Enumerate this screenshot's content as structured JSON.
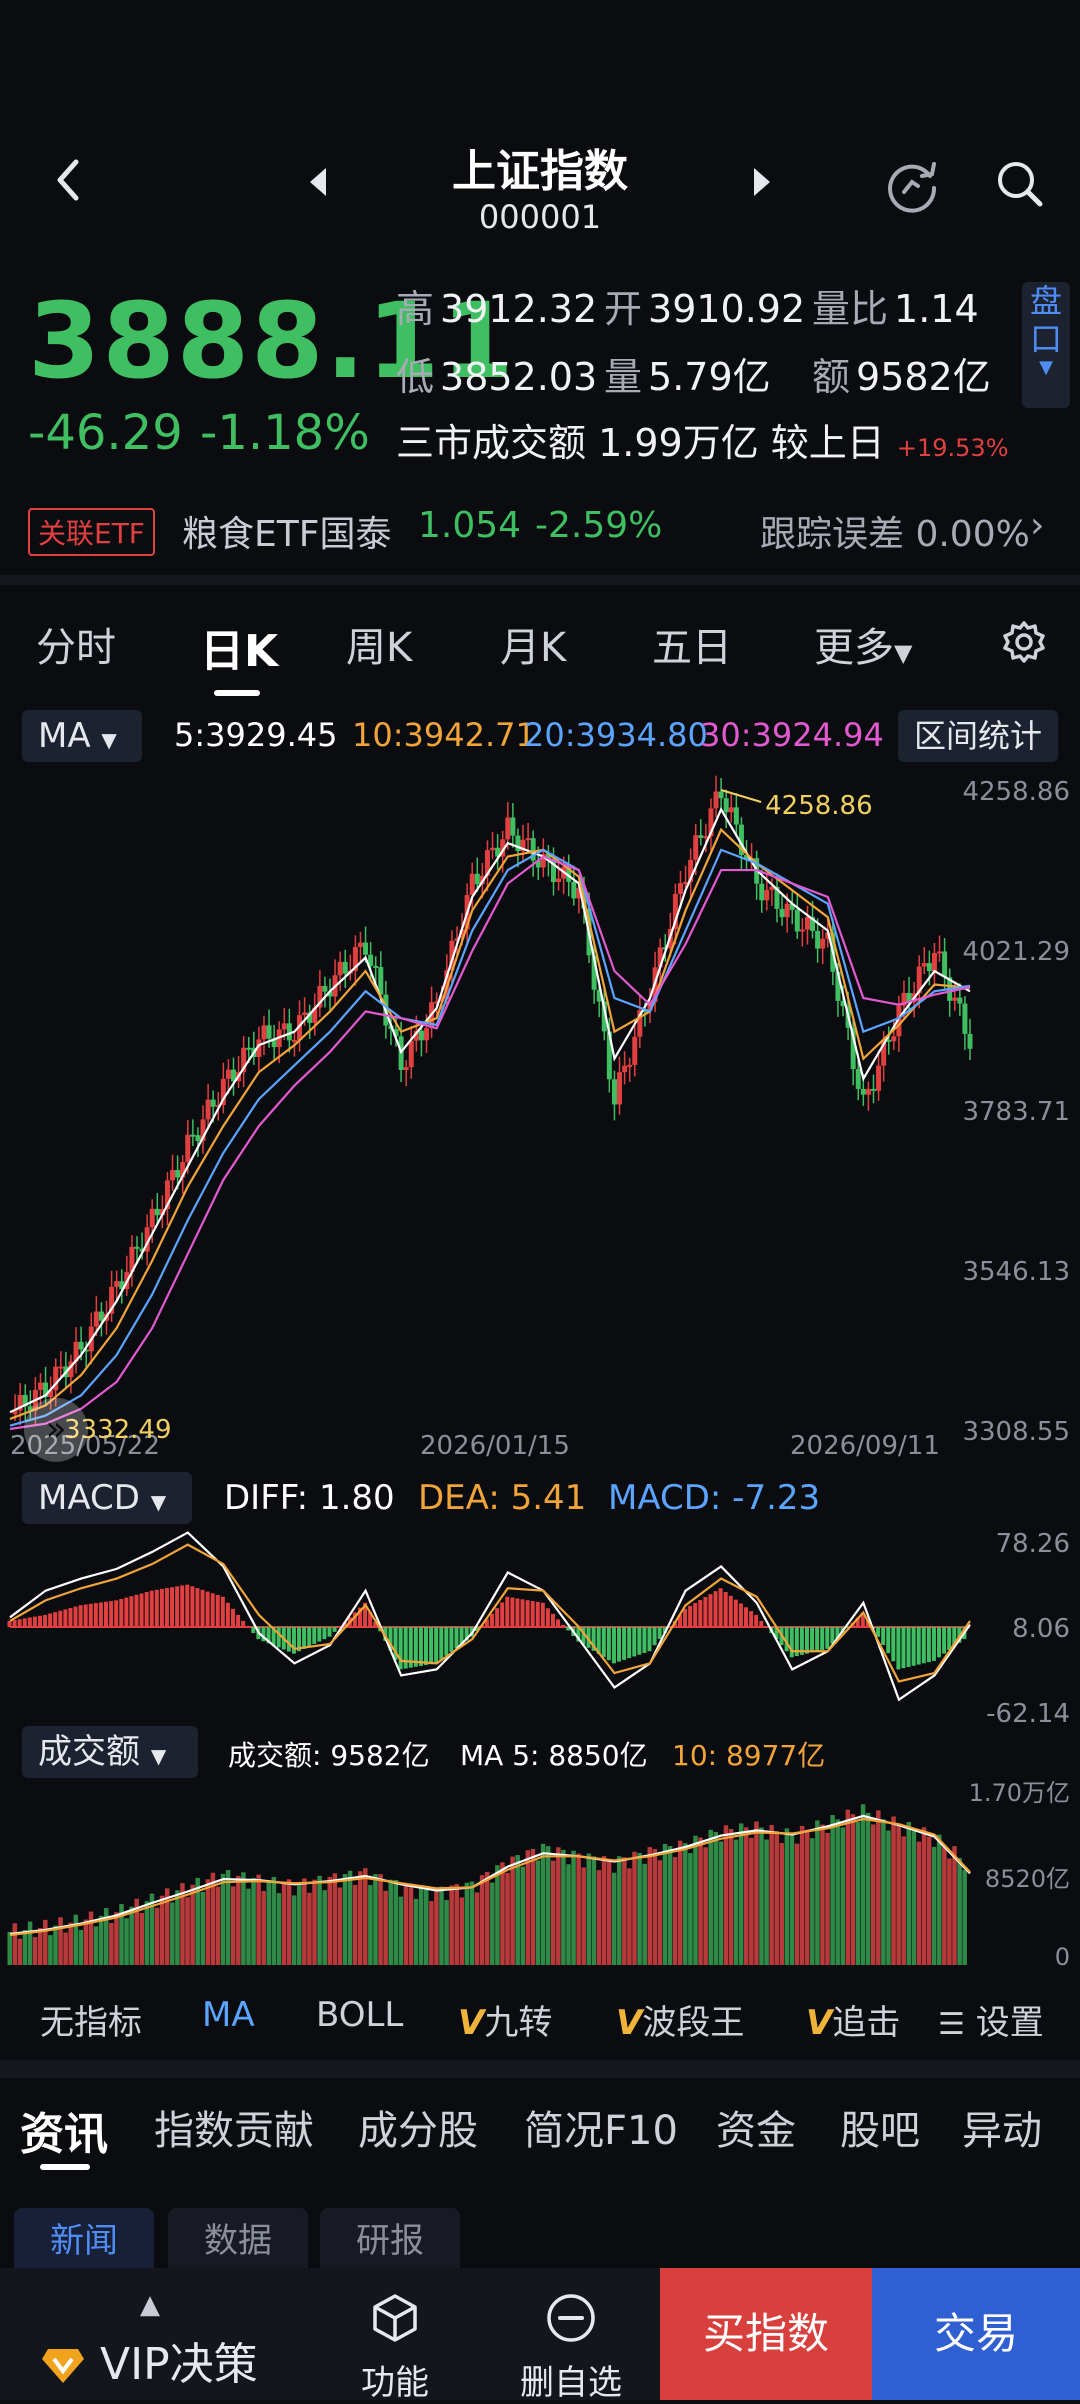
{
  "header": {
    "title": "上证指数",
    "code": "000001"
  },
  "quote": {
    "price": "3888.11",
    "change": "-46.29",
    "change_pct": "-1.18%",
    "high_label": "高",
    "high": "3912.32",
    "open_label": "开",
    "open": "3910.92",
    "vol_ratio_label": "量比",
    "vol_ratio": "1.14",
    "low_label": "低",
    "low": "3852.03",
    "volume_label": "量",
    "volume": "5.79亿",
    "amount_label": "额",
    "amount": "9582亿",
    "market_turnover": "三市成交额 1.99万亿 较上日",
    "market_turnover_chg": "+19.53%",
    "pankou": [
      "盘",
      "口"
    ]
  },
  "etf": {
    "badge": "关联ETF",
    "name": "粮食ETF国泰",
    "price": "1.054",
    "change_pct": "-2.59%",
    "tracking_error": "跟踪误差  0.00%"
  },
  "period_tabs": [
    "分时",
    "日K",
    "周K",
    "月K",
    "五日",
    "更多"
  ],
  "ma_legend": {
    "select": "MA",
    "ma5": "5:3929.45",
    "ma10": "10:3942.71",
    "ma20": "20:3934.80",
    "ma30": "30:3924.94",
    "range_button": "区间统计"
  },
  "macd_legend": {
    "select": "MACD",
    "diff": "DIFF: 1.80",
    "dea": "DEA: 5.41",
    "macd": "MACD: -7.23"
  },
  "volume_legend": {
    "select": "成交额",
    "amount": "成交额: 9582亿",
    "ma5": "MA 5: 8850亿",
    "ma10": "10: 8977亿"
  },
  "indicator_tabs": {
    "none": "无指标",
    "ma": "MA",
    "boll": "BOLL",
    "jiuzhuan": "九转",
    "boduan": "波段王",
    "zhuiji": "追击",
    "settings": "设置"
  },
  "info_tabs": [
    "资讯",
    "指数贡献",
    "成分股",
    "简况F10",
    "资金",
    "股吧",
    "异动"
  ],
  "sub_tabs": [
    "新闻",
    "数据",
    "研报"
  ],
  "bottom_bar": {
    "vip": "VIP决策",
    "function": "功能",
    "remove_watch": "删自选",
    "buy_index": "买指数",
    "trade": "交易"
  },
  "colors": {
    "up": "#e0403f",
    "down": "#3fbf62",
    "ma5": "#ffffff",
    "ma10": "#f0a43a",
    "ma20": "#5ba4ff",
    "ma30": "#e25ad0",
    "accent": "#4f8df5"
  },
  "chart_data": [
    {
      "type": "candlestick",
      "title": "日K",
      "x_ticks": [
        "2025/05/22",
        "2026/01/15",
        "2026/09/11"
      ],
      "y_ticks": [
        4258.86,
        4021.29,
        3783.71,
        3546.13,
        3308.55
      ],
      "ylim": [
        3308.55,
        4258.86
      ],
      "annotations": {
        "max": "4258.86",
        "min": "3332.49"
      },
      "series": [
        {
          "name": "MA5",
          "values": [
            3335,
            3360,
            3420,
            3500,
            3600,
            3700,
            3800,
            3880,
            3900,
            3960,
            4010,
            3870,
            3935,
            4100,
            4180,
            4160,
            4120,
            3860,
            3950,
            4110,
            4230,
            4140,
            4090,
            4050,
            3830,
            3920,
            3990,
            3960
          ]
        },
        {
          "name": "MA10",
          "values": [
            3325,
            3345,
            3390,
            3460,
            3560,
            3670,
            3760,
            3840,
            3880,
            3930,
            3990,
            3900,
            3920,
            4080,
            4160,
            4170,
            4130,
            3900,
            3930,
            4080,
            4200,
            4150,
            4110,
            4070,
            3860,
            3910,
            3970,
            3965
          ]
        },
        {
          "name": "MA20",
          "values": [
            3315,
            3330,
            3360,
            3420,
            3510,
            3620,
            3720,
            3800,
            3850,
            3900,
            3960,
            3920,
            3910,
            4050,
            4140,
            4170,
            4140,
            3950,
            3930,
            4050,
            4170,
            4150,
            4120,
            4090,
            3900,
            3920,
            3960,
            3968
          ]
        },
        {
          "name": "MA30",
          "values": [
            3310,
            3318,
            3340,
            3380,
            3460,
            3570,
            3680,
            3760,
            3820,
            3870,
            3930,
            3920,
            3905,
            4020,
            4120,
            4160,
            4140,
            3990,
            3940,
            4030,
            4140,
            4140,
            4120,
            4100,
            3950,
            3940,
            3955,
            3966
          ]
        }
      ],
      "price_path": [
        3332,
        3370,
        3430,
        3520,
        3620,
        3730,
        3820,
        3890,
        3900,
        3970,
        4030,
        3850,
        3940,
        4120,
        4200,
        4150,
        4110,
        3800,
        3960,
        4140,
        4258,
        4120,
        4070,
        4030,
        3790,
        3930,
        4020,
        3888
      ]
    },
    {
      "type": "bar",
      "title": "MACD",
      "y_ticks": [
        78.26,
        8.06,
        -62.14
      ],
      "values": [
        5,
        10,
        18,
        22,
        30,
        35,
        25,
        -10,
        -22,
        -8,
        20,
        -35,
        -30,
        -8,
        25,
        20,
        -12,
        -30,
        -20,
        15,
        32,
        10,
        -25,
        -18,
        12,
        -35,
        -28,
        -7
      ],
      "series": [
        {
          "name": "DIFF",
          "values": [
            8,
            30,
            40,
            48,
            62,
            78,
            50,
            -5,
            -30,
            -15,
            30,
            -40,
            -35,
            -5,
            45,
            30,
            -10,
            -50,
            -30,
            30,
            50,
            20,
            -35,
            -20,
            20,
            -60,
            -40,
            2
          ]
        },
        {
          "name": "DEA",
          "values": [
            5,
            22,
            32,
            40,
            52,
            68,
            52,
            10,
            -18,
            -14,
            18,
            -28,
            -30,
            -10,
            32,
            30,
            0,
            -38,
            -30,
            18,
            40,
            25,
            -20,
            -20,
            12,
            -45,
            -38,
            5
          ]
        }
      ]
    },
    {
      "type": "bar",
      "title": "成交额",
      "y_ticks": [
        "1.70万亿",
        "8520亿",
        "0"
      ],
      "values": [
        3200,
        3600,
        4200,
        5000,
        6200,
        7400,
        8600,
        8100,
        7600,
        8200,
        8800,
        7500,
        7000,
        7600,
        9800,
        11200,
        10400,
        9800,
        10800,
        11500,
        12800,
        13200,
        12400,
        13600,
        14800,
        13400,
        12200,
        9582
      ],
      "series": [
        {
          "name": "MA5",
          "values": [
            3000,
            3400,
            4000,
            4800,
            6000,
            7100,
            8300,
            8200,
            7800,
            8100,
            8600,
            7800,
            7200,
            7500,
            9500,
            10800,
            10500,
            10000,
            10600,
            11400,
            12500,
            13000,
            12600,
            13400,
            14400,
            13500,
            12400,
            8850
          ]
        },
        {
          "name": "MA10",
          "values": [
            2900,
            3300,
            3900,
            4600,
            5700,
            6800,
            8000,
            8100,
            7900,
            8000,
            8400,
            7900,
            7400,
            7500,
            9200,
            10500,
            10500,
            10100,
            10500,
            11200,
            12200,
            12800,
            12700,
            13200,
            14100,
            13600,
            12600,
            8977
          ]
        }
      ]
    }
  ]
}
